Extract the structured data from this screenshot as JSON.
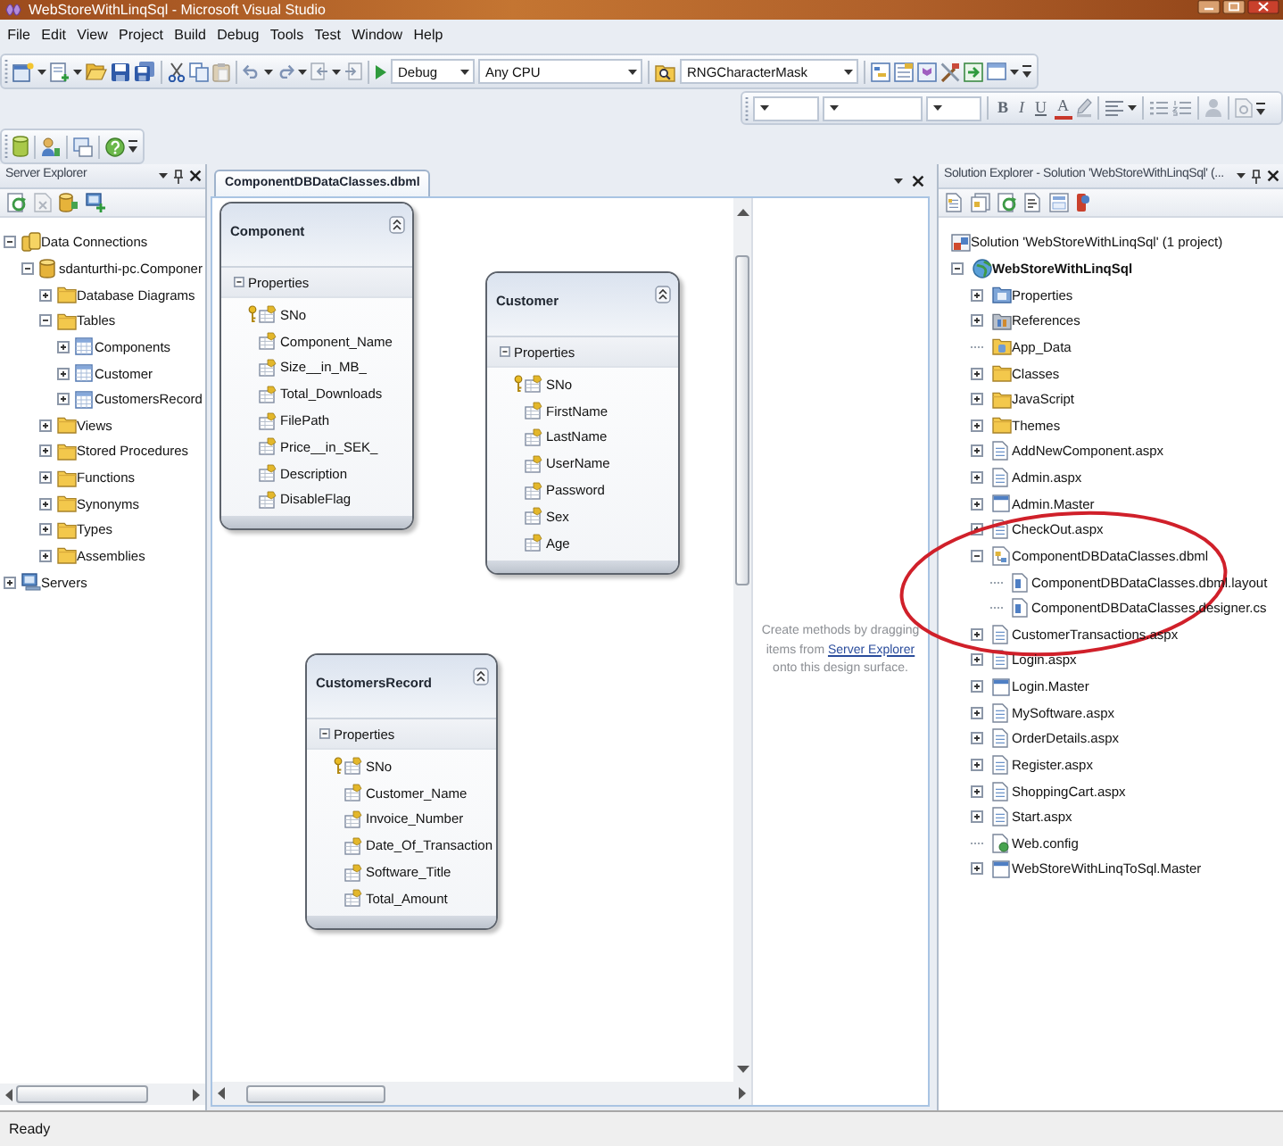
{
  "window": {
    "title": "WebStoreWithLinqSql - Microsoft Visual Studio"
  },
  "menu": [
    "File",
    "Edit",
    "View",
    "Project",
    "Build",
    "Debug",
    "Tools",
    "Test",
    "Window",
    "Help"
  ],
  "toolbar": {
    "configuration": "Debug",
    "platform": "Any CPU",
    "find": "RNGCharacterMask",
    "format_buttons": [
      {
        "kind": "bold",
        "label": "B"
      },
      {
        "kind": "italic",
        "label": "I"
      },
      {
        "kind": "underline",
        "label": "U"
      },
      {
        "kind": "color",
        "label": "A"
      }
    ]
  },
  "server_explorer": {
    "title": "Server Explorer",
    "tree": [
      {
        "label": "Data Connections",
        "kind": "connections",
        "expanded": true,
        "children": [
          {
            "label": "sdanturthi-pc.Componer",
            "kind": "database",
            "expanded": true,
            "children": [
              {
                "label": "Database Diagrams",
                "kind": "folder",
                "expanded": false
              },
              {
                "label": "Tables",
                "kind": "folder",
                "expanded": true,
                "children": [
                  {
                    "label": "Components",
                    "kind": "table",
                    "expanded": false
                  },
                  {
                    "label": "Customer",
                    "kind": "table",
                    "expanded": false
                  },
                  {
                    "label": "CustomersRecord",
                    "kind": "table",
                    "expanded": false
                  }
                ]
              },
              {
                "label": "Views",
                "kind": "folder",
                "expanded": false
              },
              {
                "label": "Stored Procedures",
                "kind": "folder",
                "expanded": false
              },
              {
                "label": "Functions",
                "kind": "folder",
                "expanded": false
              },
              {
                "label": "Synonyms",
                "kind": "folder",
                "expanded": false
              },
              {
                "label": "Types",
                "kind": "folder",
                "expanded": false
              },
              {
                "label": "Assemblies",
                "kind": "folder",
                "expanded": false
              }
            ]
          }
        ]
      },
      {
        "label": "Servers",
        "kind": "servers",
        "expanded": false
      }
    ]
  },
  "designer": {
    "tab": {
      "label": "ComponentDBDataClasses.dbml",
      "selected": true
    },
    "entities": [
      {
        "name": "Component",
        "compartment": "Properties",
        "expanded": true,
        "properties": [
          {
            "name": "SNo",
            "key": true
          },
          {
            "name": "Component_Name",
            "key": false
          },
          {
            "name": "Size__in_MB_",
            "key": false
          },
          {
            "name": "Total_Downloads",
            "key": false
          },
          {
            "name": "FilePath",
            "key": false
          },
          {
            "name": "Price__in_SEK_",
            "key": false
          },
          {
            "name": "Description",
            "key": false
          },
          {
            "name": "DisableFlag",
            "key": false
          }
        ]
      },
      {
        "name": "Customer",
        "compartment": "Properties",
        "expanded": true,
        "properties": [
          {
            "name": "SNo",
            "key": true
          },
          {
            "name": "FirstName",
            "key": false
          },
          {
            "name": "LastName",
            "key": false
          },
          {
            "name": "UserName",
            "key": false
          },
          {
            "name": "Password",
            "key": false
          },
          {
            "name": "Sex",
            "key": false
          },
          {
            "name": "Age",
            "key": false
          }
        ]
      },
      {
        "name": "CustomersRecord",
        "compartment": "Properties",
        "expanded": true,
        "properties": [
          {
            "name": "SNo",
            "key": true
          },
          {
            "name": "Customer_Name",
            "key": false
          },
          {
            "name": "Invoice_Number",
            "key": false
          },
          {
            "name": "Date_Of_Transaction",
            "key": false
          },
          {
            "name": "Software_Title",
            "key": false
          },
          {
            "name": "Total_Amount",
            "key": false
          }
        ]
      }
    ],
    "methods_hint": {
      "before": "Create methods by dragging items from",
      "link": "Server Explorer",
      "after": "onto this design surface."
    }
  },
  "solution_explorer": {
    "title": "Solution Explorer - Solution 'WebStoreWithLinqSql' (...",
    "tree": [
      {
        "label": "Solution 'WebStoreWithLinqSql' (1 project)",
        "kind": "solution",
        "children": [
          {
            "label": "WebStoreWithLinqSql",
            "kind": "project",
            "expanded": true,
            "children": [
              {
                "label": "Properties",
                "kind": "properties",
                "expanded": false
              },
              {
                "label": "References",
                "kind": "references",
                "expanded": false
              },
              {
                "label": "App_Data",
                "kind": "data_folder"
              },
              {
                "label": "Classes",
                "kind": "folder",
                "expanded": false
              },
              {
                "label": "JavaScript",
                "kind": "folder",
                "expanded": false
              },
              {
                "label": "Themes",
                "kind": "folder",
                "expanded": false
              },
              {
                "label": "AddNewComponent.aspx",
                "kind": "page",
                "expanded": false
              },
              {
                "label": "Admin.aspx",
                "kind": "page",
                "expanded": false
              },
              {
                "label": "Admin.Master",
                "kind": "master",
                "expanded": false
              },
              {
                "label": "CheckOut.aspx",
                "kind": "page",
                "expanded": false
              },
              {
                "label": "ComponentDBDataClasses.dbml",
                "kind": "dbml",
                "expanded": true,
                "children": [
                  {
                    "label": "ComponentDBDataClasses.dbml.layout",
                    "kind": "file"
                  },
                  {
                    "label": "ComponentDBDataClasses.designer.cs",
                    "kind": "file"
                  }
                ]
              },
              {
                "label": "CustomerTransactions.aspx",
                "kind": "page",
                "expanded": false
              },
              {
                "label": "Login.aspx",
                "kind": "page",
                "expanded": false
              },
              {
                "label": "Login.Master",
                "kind": "master",
                "expanded": false
              },
              {
                "label": "MySoftware.aspx",
                "kind": "page",
                "expanded": false
              },
              {
                "label": "OrderDetails.aspx",
                "kind": "page",
                "expanded": false
              },
              {
                "label": "Register.aspx",
                "kind": "page",
                "expanded": false
              },
              {
                "label": "ShoppingCart.aspx",
                "kind": "page",
                "expanded": false
              },
              {
                "label": "Start.aspx",
                "kind": "page",
                "expanded": false
              },
              {
                "label": "Web.config",
                "kind": "config"
              },
              {
                "label": "WebStoreWithLinqToSql.Master",
                "kind": "master",
                "expanded": false
              }
            ]
          }
        ]
      }
    ]
  },
  "annotations": [
    {
      "kind": "ellipse"
    }
  ],
  "status_bar": {
    "text": "Ready"
  }
}
